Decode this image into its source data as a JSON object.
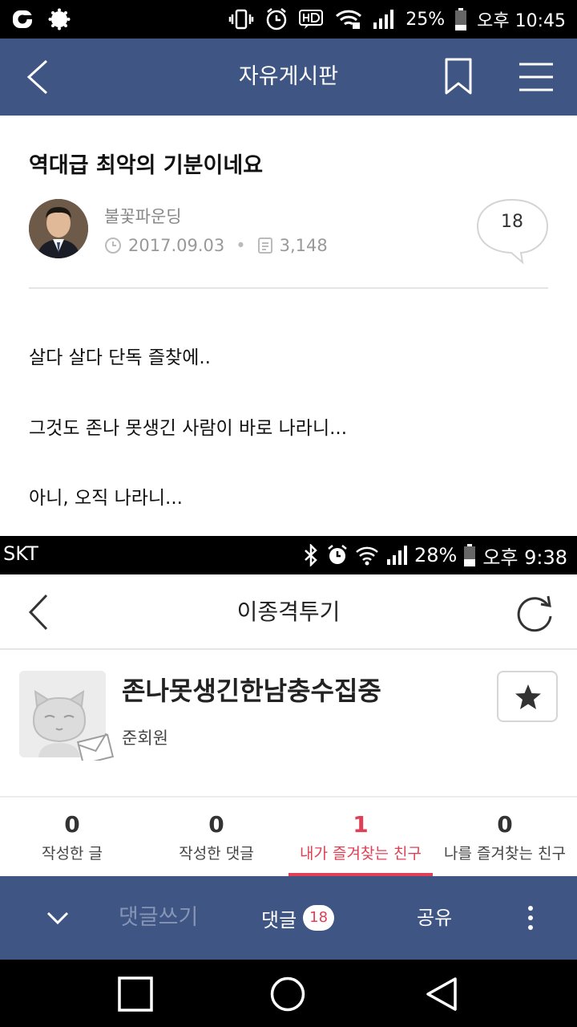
{
  "status_bar": {
    "battery": "25%",
    "time": "오후 10:45",
    "icons": [
      "o-app-icon",
      "sun-badge-icon",
      "vibrate-icon",
      "alarm-icon",
      "hd-icon",
      "wifi-icon",
      "signal-icon",
      "battery-icon"
    ]
  },
  "header": {
    "title": "자유게시판",
    "icons": [
      "back-icon",
      "bookmark-icon",
      "menu-icon"
    ]
  },
  "post": {
    "title": "역대급 최악의 기분이네요",
    "author": "불꽃파운딩",
    "date": "2017.09.03",
    "views": "3,148",
    "comment_count": "18",
    "body": [
      "살다 살다 단독 즐찾에..",
      "그것도 존나 못생긴 사람이 바로 나라니...",
      "아니, 오직 나라니..."
    ]
  },
  "embedded_screenshot": {
    "status_bar": {
      "carrier": "SKT",
      "battery": "28%",
      "time": "오후 9:38"
    },
    "header": {
      "title": "이종격투기"
    },
    "club": {
      "name": "존나못생긴한남충수집중",
      "role": "준회원"
    },
    "stats": [
      {
        "value": "0",
        "label": "작성한 글"
      },
      {
        "value": "0",
        "label": "작성한 댓글"
      },
      {
        "value": "1",
        "label": "내가 즐겨찾는 친구"
      },
      {
        "value": "0",
        "label": "나를 즐겨찾는 친구"
      }
    ],
    "active_tab_index": 2
  },
  "comment_bar": {
    "write_placeholder": "댓글쓰기",
    "comments_label": "댓글",
    "comments_badge": "18",
    "share_label": "공유"
  },
  "colors": {
    "header_bg": "#3f5584",
    "accent_red": "#e04055",
    "write_placeholder": "#8695b6"
  }
}
